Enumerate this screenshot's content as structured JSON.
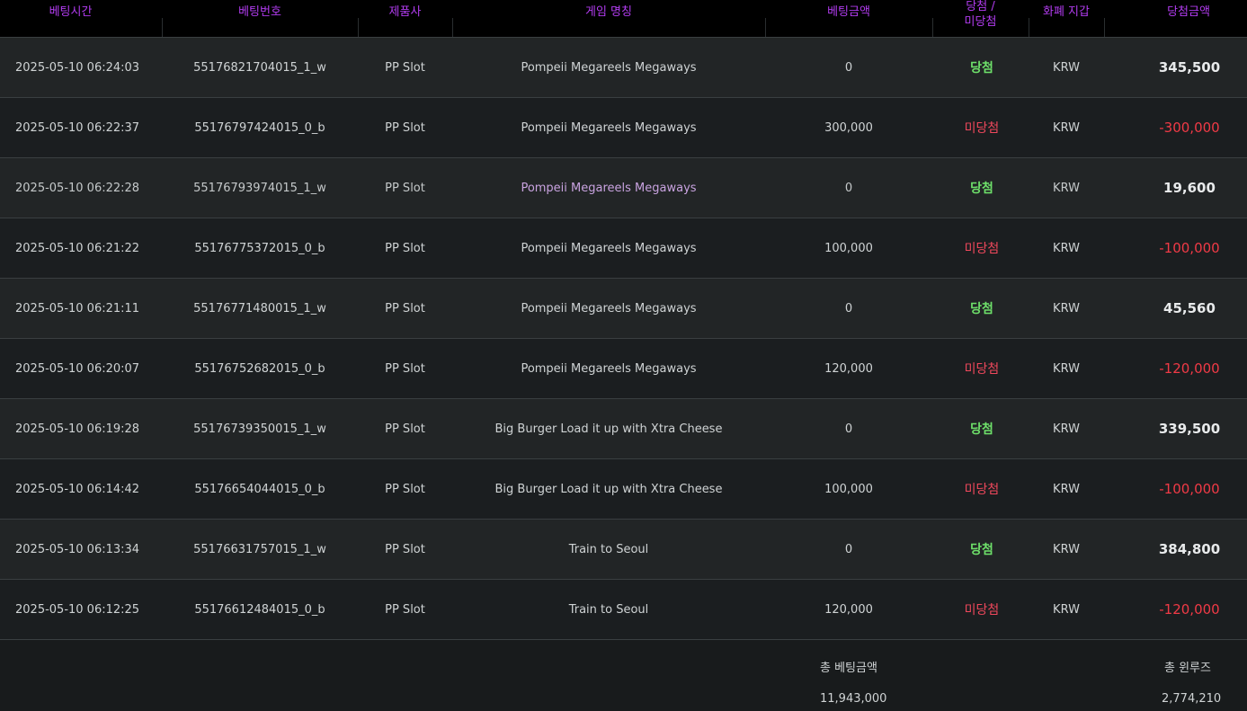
{
  "headers": {
    "bet_time": "베팅시간",
    "bet_no": "베팅번호",
    "provider": "제품사",
    "game": "게임 명칭",
    "bet_amount": "베팅금액",
    "result_top": "당첨 /",
    "result_bottom": "미당첨",
    "wallet": "화폐 지갑",
    "win_amount": "당첨금액"
  },
  "rows": [
    {
      "time": "2025-05-10 06:24:03",
      "no": "55176821704015_1_w",
      "provider": "PP Slot",
      "game": "Pompeii Megareels Megaways",
      "bet": "0",
      "result": "당첨",
      "currency": "KRW",
      "amount": "345,500",
      "win": true
    },
    {
      "time": "2025-05-10 06:22:37",
      "no": "55176797424015_0_b",
      "provider": "PP Slot",
      "game": "Pompeii Megareels Megaways",
      "bet": "300,000",
      "result": "미당첨",
      "currency": "KRW",
      "amount": "-300,000",
      "win": false
    },
    {
      "time": "2025-05-10 06:22:28",
      "no": "55176793974015_1_w",
      "provider": "PP Slot",
      "game": "Pompeii Megareels Megaways",
      "bet": "0",
      "result": "당첨",
      "currency": "KRW",
      "amount": "19,600",
      "win": true
    },
    {
      "time": "2025-05-10 06:21:22",
      "no": "55176775372015_0_b",
      "provider": "PP Slot",
      "game": "Pompeii Megareels Megaways",
      "bet": "100,000",
      "result": "미당첨",
      "currency": "KRW",
      "amount": "-100,000",
      "win": false
    },
    {
      "time": "2025-05-10 06:21:11",
      "no": "55176771480015_1_w",
      "provider": "PP Slot",
      "game": "Pompeii Megareels Megaways",
      "bet": "0",
      "result": "당첨",
      "currency": "KRW",
      "amount": "45,560",
      "win": true
    },
    {
      "time": "2025-05-10 06:20:07",
      "no": "55176752682015_0_b",
      "provider": "PP Slot",
      "game": "Pompeii Megareels Megaways",
      "bet": "120,000",
      "result": "미당첨",
      "currency": "KRW",
      "amount": "-120,000",
      "win": false
    },
    {
      "time": "2025-05-10 06:19:28",
      "no": "55176739350015_1_w",
      "provider": "PP Slot",
      "game": "Big Burger Load it up with Xtra Cheese",
      "bet": "0",
      "result": "당첨",
      "currency": "KRW",
      "amount": "339,500",
      "win": true
    },
    {
      "time": "2025-05-10 06:14:42",
      "no": "55176654044015_0_b",
      "provider": "PP Slot",
      "game": "Big Burger Load it up with Xtra Cheese",
      "bet": "100,000",
      "result": "미당첨",
      "currency": "KRW",
      "amount": "-100,000",
      "win": false
    },
    {
      "time": "2025-05-10 06:13:34",
      "no": "55176631757015_1_w",
      "provider": "PP Slot",
      "game": "Train to Seoul",
      "bet": "0",
      "result": "당첨",
      "currency": "KRW",
      "amount": "384,800",
      "win": true
    },
    {
      "time": "2025-05-10 06:12:25",
      "no": "55176612484015_0_b",
      "provider": "PP Slot",
      "game": "Train to Seoul",
      "bet": "120,000",
      "result": "미당첨",
      "currency": "KRW",
      "amount": "-120,000",
      "win": false
    }
  ],
  "footer": {
    "total_bet_label": "총 베팅금액",
    "total_bet_value": "11,943,000",
    "total_winloss_label": "총 윈루즈",
    "total_winloss_value": "2,774,210"
  },
  "colors": {
    "header_text": "#b23cf0",
    "win": "#6ee06a",
    "lose": "#f0485c",
    "negative_amount": "#f03a46"
  }
}
